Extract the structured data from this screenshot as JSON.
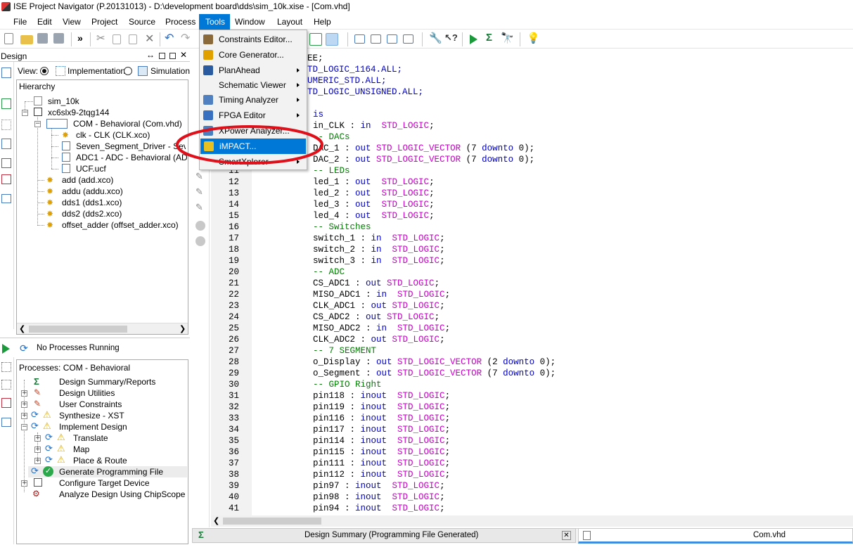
{
  "window": {
    "title": "ISE Project Navigator (P.20131013) - D:\\development board\\dds\\sim_10k.xise - [Com.vhd]"
  },
  "menubar": [
    {
      "label": "File",
      "key": "file"
    },
    {
      "label": "Edit",
      "key": "edit"
    },
    {
      "label": "View",
      "key": "view"
    },
    {
      "label": "Project",
      "key": "project"
    },
    {
      "label": "Source",
      "key": "source"
    },
    {
      "label": "Process",
      "key": "process"
    },
    {
      "label": "Tools",
      "key": "tools"
    },
    {
      "label": "Window",
      "key": "window"
    },
    {
      "label": "Layout",
      "key": "layout"
    },
    {
      "label": "Help",
      "key": "help"
    }
  ],
  "tools_menu": {
    "items": [
      {
        "label": "Constraints Editor...",
        "submenu": false,
        "icon": "constraints-icon"
      },
      {
        "label": "Core Generator...",
        "submenu": false,
        "icon": "core-generator-icon"
      },
      {
        "label": "PlanAhead",
        "submenu": true,
        "icon": "planahead-icon"
      },
      {
        "label": "Schematic Viewer",
        "submenu": true,
        "icon": ""
      },
      {
        "label": "Timing Analyzer",
        "submenu": true,
        "icon": "timing-icon"
      },
      {
        "label": "FPGA Editor",
        "submenu": true,
        "icon": "fpga-editor-icon"
      },
      {
        "label": "XPower Analyzer...",
        "submenu": false,
        "icon": "xpower-icon"
      },
      {
        "label": "iMPACT...",
        "submenu": false,
        "icon": "impact-icon",
        "highlighted": true
      },
      {
        "label": "SmartXplorer",
        "submenu": true,
        "icon": ""
      }
    ]
  },
  "design_panel": {
    "title": "Design",
    "view_label": "View:",
    "radio_implementation": "Implementation",
    "radio_simulation": "Simulation",
    "hierarchy_label": "Hierarchy",
    "tree": [
      {
        "label": "sim_10k"
      },
      {
        "label": "xc6slx9-2tqg144"
      },
      {
        "label": "COM - Behavioral (Com.vhd)"
      },
      {
        "label": "clk - CLK (CLK.xco)"
      },
      {
        "label": "Seven_Segment_Driver - Seve"
      },
      {
        "label": "ADC1 - ADC - Behavioral (ADC"
      },
      {
        "label": "UCF.ucf"
      },
      {
        "label": "add (add.xco)"
      },
      {
        "label": "addu (addu.xco)"
      },
      {
        "label": "dds1 (dds1.xco)"
      },
      {
        "label": "dds2 (dds2.xco)"
      },
      {
        "label": "offset_adder (offset_adder.xco)"
      }
    ]
  },
  "process_panel": {
    "status": "No Processes Running",
    "processes_label": "Processes: COM - Behavioral",
    "items": [
      {
        "label": "Design Summary/Reports"
      },
      {
        "label": "Design Utilities"
      },
      {
        "label": "User Constraints"
      },
      {
        "label": "Synthesize - XST"
      },
      {
        "label": "Implement Design"
      },
      {
        "label": "Translate"
      },
      {
        "label": "Map"
      },
      {
        "label": "Place & Route"
      },
      {
        "label": "Generate Programming File"
      },
      {
        "label": "Configure Target Device"
      },
      {
        "label": "Analyze Design Using ChipScope"
      }
    ]
  },
  "editor": {
    "partial_lines": [
      {
        "text": "EE;",
        "cls": "tx"
      },
      {
        "text": "TD_LOGIC_1164.ALL;",
        "cls": "kw"
      },
      {
        "text": "UMERIC_STD.ALL;",
        "cls": "kw"
      },
      {
        "text": "TD_LOGIC_UNSIGNED.ALL;",
        "cls": "kw"
      }
    ],
    "hidden_lines": [
      {
        "n": "",
        "html": "<span class='kw'>is</span>"
      },
      {
        "n": "",
        "html": "<span class='tx'>in_CLK : </span><span class='kw'>in</span>  <span class='ty'>STD_LOGIC</span>;"
      },
      {
        "n": "",
        "html": "<span class='cm'>-- DACs</span>"
      },
      {
        "n": "",
        "html": "<span class='tx'>DAC_1 : </span><span class='kw'>out</span> <span class='ty'>STD_LOGIC_VECTOR</span> (7 <span class='kw'>downto</span> 0);"
      },
      {
        "n": "",
        "html": "<span class='tx'>DAC_2 : </span><span class='kw'>out</span> <span class='ty'>STD_LOGIC_VECTOR</span> (7 <span class='kw'>downto</span> 0);"
      },
      {
        "n": "11",
        "html": "<span class='cm'>-- LEDs</span>"
      }
    ],
    "lines": [
      {
        "n": "12",
        "html": "led_1 : <span class='kw'>out</span>  <span class='ty'>STD_LOGIC</span>;"
      },
      {
        "n": "13",
        "html": "led_2 : <span class='kw'>out</span>  <span class='ty'>STD_LOGIC</span>;"
      },
      {
        "n": "14",
        "html": "led_3 : <span class='kw'>out</span>  <span class='ty'>STD_LOGIC</span>;"
      },
      {
        "n": "15",
        "html": "led_4 : <span class='kw'>out</span>  <span class='ty'>STD_LOGIC</span>;"
      },
      {
        "n": "16",
        "html": "<span class='cm'>-- Switches</span>"
      },
      {
        "n": "17",
        "html": "switch_1 : <span class='kw'>in</span>  <span class='ty'>STD_LOGIC</span>;"
      },
      {
        "n": "18",
        "html": "switch_2 : <span class='kw'>in</span>  <span class='ty'>STD_LOGIC</span>;"
      },
      {
        "n": "19",
        "html": "switch_3 : <span class='kw'>in</span>  <span class='ty'>STD_LOGIC</span>;"
      },
      {
        "n": "20",
        "html": "<span class='cm'>-- ADC</span>"
      },
      {
        "n": "21",
        "html": "CS_ADC1 : <span class='kw'>out</span> <span class='ty'>STD_LOGIC</span>;"
      },
      {
        "n": "22",
        "html": "MISO_ADC1 : <span class='kw'>in</span>  <span class='ty'>STD_LOGIC</span>;"
      },
      {
        "n": "23",
        "html": "CLK_ADC1 : <span class='kw'>out</span> <span class='ty'>STD_LOGIC</span>;"
      },
      {
        "n": "24",
        "html": "CS_ADC2 : <span class='kw'>out</span> <span class='ty'>STD_LOGIC</span>;"
      },
      {
        "n": "25",
        "html": "MISO_ADC2 : <span class='kw'>in</span>  <span class='ty'>STD_LOGIC</span>;"
      },
      {
        "n": "26",
        "html": "CLK_ADC2 : <span class='kw'>out</span> <span class='ty'>STD_LOGIC</span>;"
      },
      {
        "n": "27",
        "html": "<span class='cm'>-- 7 SEGMENT</span>"
      },
      {
        "n": "28",
        "html": "o_Display : <span class='kw'>out</span> <span class='ty'>STD_LOGIC_VECTOR</span> (2 <span class='kw'>downto</span> 0);"
      },
      {
        "n": "29",
        "html": "o_Segment : <span class='kw'>out</span> <span class='ty'>STD_LOGIC_VECTOR</span> (7 <span class='kw'>downto</span> 0);"
      },
      {
        "n": "30",
        "html": "<span class='cm'>-- GPIO Right</span>"
      },
      {
        "n": "31",
        "html": "pin118 : <span class='kw'>inout</span>  <span class='ty'>STD_LOGIC</span>;"
      },
      {
        "n": "32",
        "html": "pin119 : <span class='kw'>inout</span>  <span class='ty'>STD_LOGIC</span>;"
      },
      {
        "n": "33",
        "html": "pin116 : <span class='kw'>inout</span>  <span class='ty'>STD_LOGIC</span>;"
      },
      {
        "n": "34",
        "html": "pin117 : <span class='kw'>inout</span>  <span class='ty'>STD_LOGIC</span>;"
      },
      {
        "n": "35",
        "html": "pin114 : <span class='kw'>inout</span>  <span class='ty'>STD_LOGIC</span>;"
      },
      {
        "n": "36",
        "html": "pin115 : <span class='kw'>inout</span>  <span class='ty'>STD_LOGIC</span>;"
      },
      {
        "n": "37",
        "html": "pin111 : <span class='kw'>inout</span>  <span class='ty'>STD_LOGIC</span>;"
      },
      {
        "n": "38",
        "html": "pin112 : <span class='kw'>inout</span>  <span class='ty'>STD_LOGIC</span>;"
      },
      {
        "n": "39",
        "html": "pin97 : <span class='kw'>inout</span>  <span class='ty'>STD_LOGIC</span>;"
      },
      {
        "n": "40",
        "html": "pin98 : <span class='kw'>inout</span>  <span class='ty'>STD_LOGIC</span>;"
      },
      {
        "n": "41",
        "html": "pin94 : <span class='kw'>inout</span>  <span class='ty'>STD_LOGIC</span>;"
      }
    ]
  },
  "bottom_tabs": {
    "design_summary": "Design Summary (Programming File Generated)",
    "com_vhd": "Com.vhd"
  },
  "colors": {
    "highlight": "#0078d7",
    "annotation_red": "#e0101a",
    "keyword": "#0000c8",
    "type": "#c800c8",
    "comment": "#008000"
  }
}
